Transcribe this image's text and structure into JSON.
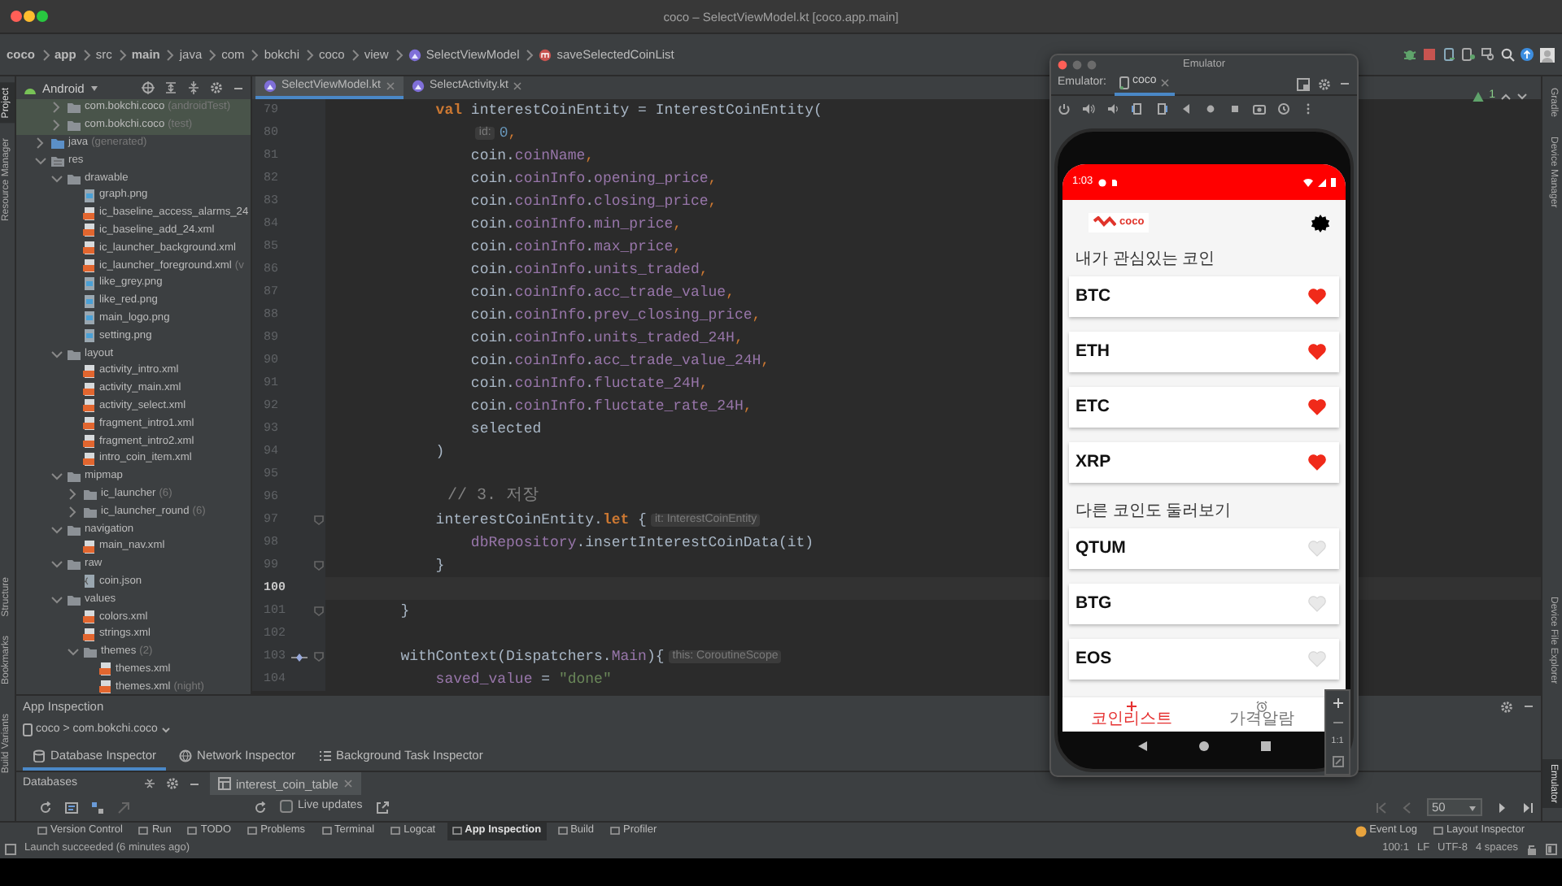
{
  "window": {
    "title": "coco – SelectViewModel.kt [coco.app.main]"
  },
  "breadcrumb": [
    {
      "label": "coco",
      "kind": "module"
    },
    {
      "label": "app",
      "kind": "module"
    },
    {
      "label": "src",
      "kind": "package"
    },
    {
      "label": "main",
      "kind": "module"
    },
    {
      "label": "java",
      "kind": "package"
    },
    {
      "label": "com",
      "kind": "package"
    },
    {
      "label": "bokchi",
      "kind": "package"
    },
    {
      "label": "coco",
      "kind": "package"
    },
    {
      "label": "view",
      "kind": "package"
    },
    {
      "label": "SelectViewModel",
      "kind": "class"
    },
    {
      "label": "saveSelectedCoinList",
      "kind": "method"
    }
  ],
  "left_strip": {
    "upper": [
      {
        "label": "Project",
        "selected": true
      },
      {
        "label": "Resource Manager",
        "selected": false
      }
    ],
    "lower": [
      {
        "label": "Structure",
        "selected": false
      },
      {
        "label": "Bookmarks",
        "selected": false
      }
    ],
    "panel": [
      {
        "label": "Build Variants",
        "selected": false
      }
    ]
  },
  "right_strip": {
    "upper": [
      {
        "label": "Gradle",
        "selected": false
      },
      {
        "label": "Device Manager",
        "selected": false
      }
    ],
    "lower": [
      {
        "label": "Device File Explorer",
        "selected": false
      }
    ],
    "panel": [
      {
        "label": "Emulator",
        "selected": true
      }
    ]
  },
  "project_panel": {
    "view": "Android",
    "partial_items": [
      {
        "label": "com.bokchi.coco",
        "note": "(androidTest)",
        "kind": "package",
        "expanded": false
      },
      {
        "label": "com.bokchi.coco",
        "note": "(test)",
        "kind": "package",
        "expanded": false
      }
    ],
    "tree": [
      {
        "label": "java",
        "note": "(generated)",
        "kind": "generated",
        "expanded": false
      },
      {
        "label": "res",
        "kind": "resources",
        "expanded": true,
        "children": [
          {
            "label": "drawable",
            "kind": "folder",
            "expanded": true,
            "children": [
              {
                "label": "graph.png",
                "kind": "image"
              },
              {
                "label": "ic_baseline_access_alarms_24",
                "kind": "xml"
              },
              {
                "label": "ic_baseline_add_24.xml",
                "kind": "xml"
              },
              {
                "label": "ic_launcher_background.xml",
                "kind": "xml"
              },
              {
                "label": "ic_launcher_foreground.xml",
                "note": "(v",
                "kind": "xml"
              },
              {
                "label": "like_grey.png",
                "kind": "image"
              },
              {
                "label": "like_red.png",
                "kind": "image"
              },
              {
                "label": "main_logo.png",
                "kind": "image"
              },
              {
                "label": "setting.png",
                "kind": "image"
              }
            ]
          },
          {
            "label": "layout",
            "kind": "folder",
            "expanded": true,
            "children": [
              {
                "label": "activity_intro.xml",
                "kind": "xml"
              },
              {
                "label": "activity_main.xml",
                "kind": "xml"
              },
              {
                "label": "activity_select.xml",
                "kind": "xml"
              },
              {
                "label": "fragment_intro1.xml",
                "kind": "xml"
              },
              {
                "label": "fragment_intro2.xml",
                "kind": "xml"
              },
              {
                "label": "intro_coin_item.xml",
                "kind": "xml"
              }
            ]
          },
          {
            "label": "mipmap",
            "kind": "folder",
            "expanded": true,
            "children": [
              {
                "label": "ic_launcher",
                "note": "(6)",
                "kind": "folder",
                "expanded": false
              },
              {
                "label": "ic_launcher_round",
                "note": "(6)",
                "kind": "folder",
                "expanded": false
              }
            ]
          },
          {
            "label": "navigation",
            "kind": "folder",
            "expanded": true,
            "children": [
              {
                "label": "main_nav.xml",
                "kind": "xml"
              }
            ]
          },
          {
            "label": "raw",
            "kind": "folder",
            "expanded": true,
            "children": [
              {
                "label": "coin.json",
                "kind": "json"
              }
            ]
          },
          {
            "label": "values",
            "kind": "folder",
            "expanded": true,
            "children": [
              {
                "label": "colors.xml",
                "kind": "xml"
              },
              {
                "label": "strings.xml",
                "kind": "xml"
              },
              {
                "label": "themes",
                "note": "(2)",
                "kind": "folder",
                "expanded": true,
                "children": [
                  {
                    "label": "themes.xml",
                    "kind": "xml"
                  },
                  {
                    "label": "themes.xml",
                    "note": "(night)",
                    "kind": "xml"
                  }
                ]
              }
            ]
          }
        ]
      }
    ]
  },
  "editor_tabs": [
    {
      "label": "SelectViewModel.kt",
      "selected": true
    },
    {
      "label": "SelectActivity.kt",
      "selected": false
    }
  ],
  "editor_status": {
    "warnings": "1"
  },
  "code_lines": [
    {
      "number": "79",
      "current": false,
      "fold": false,
      "segments": [
        {
          "kind": "keyword",
          "text": "            val"
        },
        {
          "kind": "plain",
          "text": " interestCoinEntity = InterestCoinEntity("
        }
      ]
    },
    {
      "number": "80",
      "current": false,
      "fold": false,
      "segments": [
        {
          "kind": "hint",
          "text": "                id:"
        },
        {
          "kind": "number",
          "text": "0"
        },
        {
          "kind": "punct",
          "text": ","
        }
      ]
    },
    {
      "number": "81",
      "current": false,
      "fold": false,
      "segments": [
        {
          "kind": "plain",
          "text": "                coin."
        },
        {
          "kind": "field",
          "text": "coinName"
        },
        {
          "kind": "punct",
          "text": ","
        }
      ]
    },
    {
      "number": "82",
      "current": false,
      "fold": false,
      "segments": [
        {
          "kind": "plain",
          "text": "                coin."
        },
        {
          "kind": "field",
          "text": "coinInfo"
        },
        {
          "kind": "plain",
          "text": "."
        },
        {
          "kind": "field",
          "text": "opening_price"
        },
        {
          "kind": "punct",
          "text": ","
        }
      ]
    },
    {
      "number": "83",
      "current": false,
      "fold": false,
      "segments": [
        {
          "kind": "plain",
          "text": "                coin."
        },
        {
          "kind": "field",
          "text": "coinInfo"
        },
        {
          "kind": "plain",
          "text": "."
        },
        {
          "kind": "field",
          "text": "closing_price"
        },
        {
          "kind": "punct",
          "text": ","
        }
      ]
    },
    {
      "number": "84",
      "current": false,
      "fold": false,
      "segments": [
        {
          "kind": "plain",
          "text": "                coin."
        },
        {
          "kind": "field",
          "text": "coinInfo"
        },
        {
          "kind": "plain",
          "text": "."
        },
        {
          "kind": "field",
          "text": "min_price"
        },
        {
          "kind": "punct",
          "text": ","
        }
      ]
    },
    {
      "number": "85",
      "current": false,
      "fold": false,
      "segments": [
        {
          "kind": "plain",
          "text": "                coin."
        },
        {
          "kind": "field",
          "text": "coinInfo"
        },
        {
          "kind": "plain",
          "text": "."
        },
        {
          "kind": "field",
          "text": "max_price"
        },
        {
          "kind": "punct",
          "text": ","
        }
      ]
    },
    {
      "number": "86",
      "current": false,
      "fold": false,
      "segments": [
        {
          "kind": "plain",
          "text": "                coin."
        },
        {
          "kind": "field",
          "text": "coinInfo"
        },
        {
          "kind": "plain",
          "text": "."
        },
        {
          "kind": "field",
          "text": "units_traded"
        },
        {
          "kind": "punct",
          "text": ","
        }
      ]
    },
    {
      "number": "87",
      "current": false,
      "fold": false,
      "segments": [
        {
          "kind": "plain",
          "text": "                coin."
        },
        {
          "kind": "field",
          "text": "coinInfo"
        },
        {
          "kind": "plain",
          "text": "."
        },
        {
          "kind": "field",
          "text": "acc_trade_value"
        },
        {
          "kind": "punct",
          "text": ","
        }
      ]
    },
    {
      "number": "88",
      "current": false,
      "fold": false,
      "segments": [
        {
          "kind": "plain",
          "text": "                coin."
        },
        {
          "kind": "field",
          "text": "coinInfo"
        },
        {
          "kind": "plain",
          "text": "."
        },
        {
          "kind": "field",
          "text": "prev_closing_price"
        },
        {
          "kind": "punct",
          "text": ","
        }
      ]
    },
    {
      "number": "89",
      "current": false,
      "fold": false,
      "segments": [
        {
          "kind": "plain",
          "text": "                coin."
        },
        {
          "kind": "field",
          "text": "coinInfo"
        },
        {
          "kind": "plain",
          "text": "."
        },
        {
          "kind": "field",
          "text": "units_traded_24H"
        },
        {
          "kind": "punct",
          "text": ","
        }
      ]
    },
    {
      "number": "90",
      "current": false,
      "fold": false,
      "segments": [
        {
          "kind": "plain",
          "text": "                coin."
        },
        {
          "kind": "field",
          "text": "coinInfo"
        },
        {
          "kind": "plain",
          "text": "."
        },
        {
          "kind": "field",
          "text": "acc_trade_value_24H"
        },
        {
          "kind": "punct",
          "text": ","
        }
      ]
    },
    {
      "number": "91",
      "current": false,
      "fold": false,
      "segments": [
        {
          "kind": "plain",
          "text": "                coin."
        },
        {
          "kind": "field",
          "text": "coinInfo"
        },
        {
          "kind": "plain",
          "text": "."
        },
        {
          "kind": "field",
          "text": "fluctate_24H"
        },
        {
          "kind": "punct",
          "text": ","
        }
      ]
    },
    {
      "number": "92",
      "current": false,
      "fold": false,
      "segments": [
        {
          "kind": "plain",
          "text": "                coin."
        },
        {
          "kind": "field",
          "text": "coinInfo"
        },
        {
          "kind": "plain",
          "text": "."
        },
        {
          "kind": "field",
          "text": "fluctate_rate_24H"
        },
        {
          "kind": "punct",
          "text": ","
        }
      ]
    },
    {
      "number": "93",
      "current": false,
      "fold": false,
      "segments": [
        {
          "kind": "plain",
          "text": "                selected"
        }
      ]
    },
    {
      "number": "94",
      "current": false,
      "fold": false,
      "segments": [
        {
          "kind": "plain",
          "text": "            )"
        }
      ]
    },
    {
      "number": "95",
      "current": false,
      "fold": false
    },
    {
      "number": "96",
      "current": false,
      "fold": false,
      "segments": [
        {
          "kind": "comment",
          "text": "            // 3. 저장"
        }
      ]
    },
    {
      "number": "97",
      "current": false,
      "fold": true,
      "segments": [
        {
          "kind": "plain",
          "text": "            interestCoinEntity."
        },
        {
          "kind": "keyword",
          "text": "let"
        },
        {
          "kind": "plain",
          "text": " {"
        },
        {
          "kind": "hint",
          "text": "it: InterestCoinEntity"
        }
      ]
    },
    {
      "number": "98",
      "current": false,
      "fold": false,
      "segments": [
        {
          "kind": "field",
          "text": "                dbRepository"
        },
        {
          "kind": "plain",
          "text": ".insertInterestCoinData(it)"
        }
      ]
    },
    {
      "number": "99",
      "current": false,
      "fold": true,
      "segments": [
        {
          "kind": "plain",
          "text": "            }"
        }
      ]
    },
    {
      "number": "100",
      "current": true,
      "fold": false
    },
    {
      "number": "101",
      "current": false,
      "fold": true,
      "segments": [
        {
          "kind": "plain",
          "text": "        }"
        }
      ]
    },
    {
      "number": "102",
      "current": false,
      "fold": false
    },
    {
      "number": "103",
      "current": false,
      "fold": true,
      "suspend_call": true,
      "segments": [
        {
          "kind": "plain",
          "text": "        withContext(Dispatchers."
        },
        {
          "kind": "field",
          "text": "Main"
        },
        {
          "kind": "plain",
          "text": "){"
        },
        {
          "kind": "hint",
          "text": "this: CoroutineScope"
        }
      ]
    },
    {
      "number": "104",
      "current": false,
      "fold": false,
      "segments": [
        {
          "kind": "field",
          "text": "            saved_value"
        },
        {
          "kind": "plain",
          "text": " = "
        },
        {
          "kind": "string",
          "text": "\"done\""
        }
      ]
    }
  ],
  "emulator": {
    "title": "Emulator",
    "label": "Emulator:",
    "tabs": [
      {
        "label": "coco",
        "selected": true
      }
    ],
    "phone": {
      "time": "1:03",
      "app_name": "coco",
      "sections": [
        {
          "title": "내가 관심있는 코인",
          "coins": [
            {
              "name": "BTC",
              "liked": true
            },
            {
              "name": "ETH",
              "liked": true
            },
            {
              "name": "ETC",
              "liked": true
            },
            {
              "name": "XRP",
              "liked": true
            }
          ]
        },
        {
          "title": "다른 코인도 둘러보기",
          "coins": [
            {
              "name": "QTUM",
              "liked": false
            },
            {
              "name": "BTG",
              "liked": false
            },
            {
              "name": "EOS",
              "liked": false
            }
          ]
        }
      ],
      "nav": [
        {
          "label": "코인리스트",
          "kind": "add",
          "selected": true
        },
        {
          "label": "가격알람",
          "kind": "alarm",
          "selected": false
        }
      ]
    },
    "zoom_ratio": "1:1"
  },
  "app_inspection": {
    "title": "App Inspection",
    "process": "coco > com.bokchi.coco",
    "tabs": [
      {
        "label": "Database Inspector",
        "kind": "database",
        "selected": true
      },
      {
        "label": "Network Inspector",
        "kind": "network",
        "selected": false
      },
      {
        "label": "Background Task Inspector",
        "kind": "tasks",
        "selected": false
      }
    ],
    "databases_label": "Databases",
    "table_tabs": [
      {
        "label": "interest_coin_table"
      }
    ],
    "live_updates": {
      "label": "Live updates",
      "checked": false
    },
    "page_size": "50"
  },
  "tool_windows": [
    {
      "label": "Version Control",
      "selected": false
    },
    {
      "label": "Run",
      "selected": false
    },
    {
      "label": "TODO",
      "selected": false
    },
    {
      "label": "Problems",
      "selected": false
    },
    {
      "label": "Terminal",
      "selected": false
    },
    {
      "label": "Logcat",
      "selected": false
    },
    {
      "label": "App Inspection",
      "selected": true
    },
    {
      "label": "Build",
      "selected": false
    },
    {
      "label": "Profiler",
      "selected": false
    }
  ],
  "right_tools": [
    "Event Log",
    "Layout Inspector"
  ],
  "status_bar": {
    "message": "Launch succeeded (6 minutes ago)",
    "items": [
      "100:1",
      "LF",
      "UTF-8",
      "4 spaces"
    ]
  }
}
